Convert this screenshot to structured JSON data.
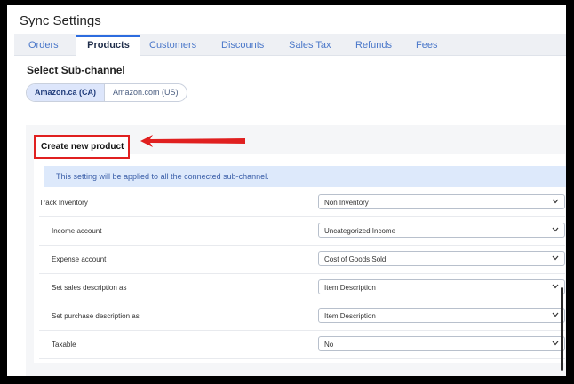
{
  "page_title": "Sync Settings",
  "tabs": [
    {
      "label": "Orders",
      "active": false
    },
    {
      "label": "Products",
      "active": true
    },
    {
      "label": "Customers",
      "active": false
    },
    {
      "label": "Discounts",
      "active": false
    },
    {
      "label": "Sales Tax",
      "active": false
    },
    {
      "label": "Refunds",
      "active": false
    },
    {
      "label": "Fees",
      "active": false
    }
  ],
  "subchannel": {
    "title": "Select Sub-channel",
    "options": [
      {
        "label": "Amazon.ca (CA)",
        "active": true
      },
      {
        "label": "Amazon.com (US)",
        "active": false
      }
    ]
  },
  "section": {
    "title": "Create new product",
    "info": "This setting will be applied to all the connected sub-channel."
  },
  "settings": [
    {
      "label": "Track Inventory",
      "value": "Non Inventory"
    },
    {
      "label": "Income account",
      "value": "Uncategorized Income"
    },
    {
      "label": "Expense account",
      "value": "Cost of Goods Sold"
    },
    {
      "label": "Set sales description as",
      "value": "Item Description"
    },
    {
      "label": "Set purchase description as",
      "value": "Item Description"
    },
    {
      "label": "Taxable",
      "value": "No"
    }
  ],
  "icons": {
    "select": "chevron-down-icon",
    "annotation": "arrow-left-icon"
  },
  "colors": {
    "accent": "#2d6cdf",
    "annotation": "#e02020",
    "info_bg": "#dde9fb"
  }
}
